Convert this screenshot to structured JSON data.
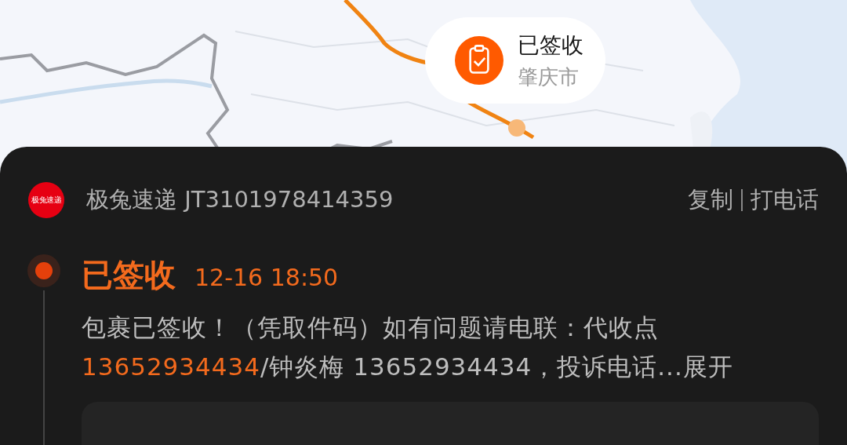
{
  "map": {
    "popup": {
      "status": "已签收",
      "city": "肇庆市"
    }
  },
  "courier": {
    "logo": "极兔速递",
    "title": "极兔速递 JT3101978414359",
    "actions": [
      "复制",
      "打电话"
    ]
  },
  "events": [
    {
      "status": "已签收",
      "time": "12-16 18:50",
      "current": true,
      "text": "包裹已签收！（凭取件码）如有问题请电联：代收点",
      "phone": "13652934434",
      "rest": "/钟炎梅 13652934434，投诉电话...",
      "expand": "展开"
    }
  ]
}
